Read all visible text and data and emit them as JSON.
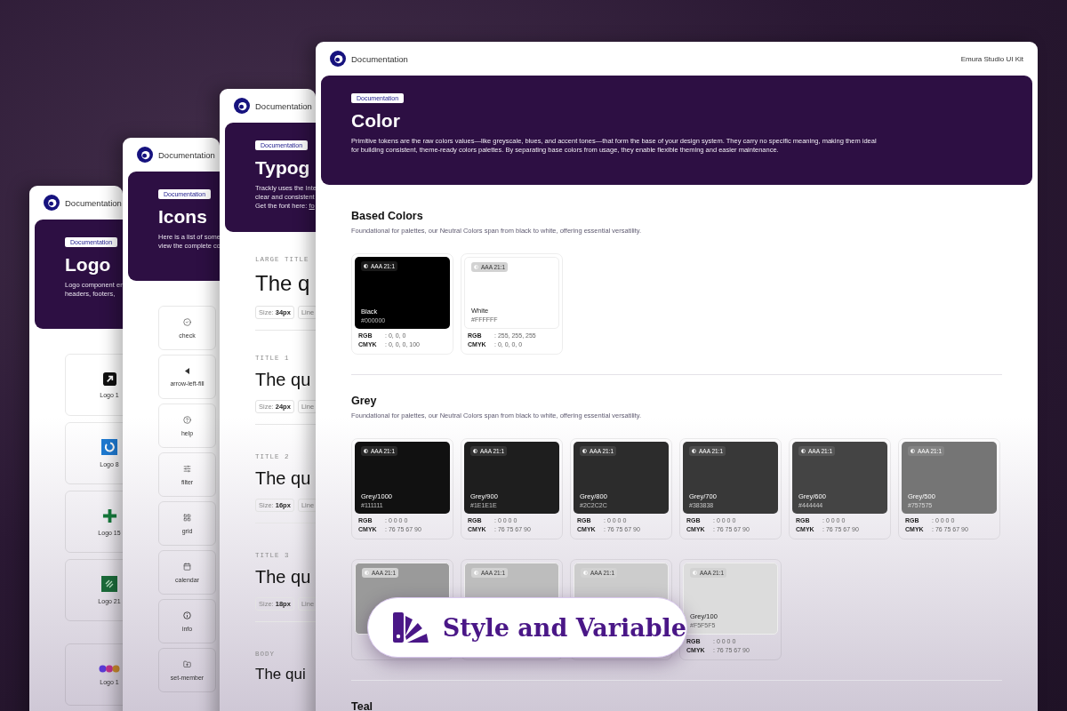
{
  "panels": [
    {
      "kind": "logos",
      "header": {
        "title": "Documentation"
      },
      "hero": {
        "badge": "Documentation",
        "title": "Logo",
        "description_lines": [
          "Logo component en",
          "headers, footers,"
        ]
      },
      "items": [
        {
          "label": "Logo 1"
        },
        {
          "label": "Logo 8"
        },
        {
          "label": "Logo 15"
        },
        {
          "label": "Logo 21"
        },
        {
          "label": "Logo 1"
        }
      ]
    },
    {
      "kind": "icons",
      "header": {
        "title": "Documentation"
      },
      "hero": {
        "badge": "Documentation",
        "title": "Icons",
        "description_lines": [
          "Here is a list of some",
          "view the complete co"
        ]
      },
      "items": [
        {
          "label": "check"
        },
        {
          "label": "arrow-left-fill"
        },
        {
          "label": "help"
        },
        {
          "label": "filter"
        },
        {
          "label": "grid"
        },
        {
          "label": "calendar"
        },
        {
          "label": "info"
        },
        {
          "label": "set-member"
        }
      ]
    },
    {
      "kind": "typography",
      "header": {
        "title": "Documentation"
      },
      "hero": {
        "badge": "Documentation",
        "title": "Typog",
        "description_lines": [
          "Trackly uses the Inte",
          "clear and consistent"
        ],
        "font_line": {
          "prefix": "Get the font here:",
          "link": "fo"
        }
      },
      "styles": [
        {
          "label": "LARGE TITLE",
          "sample": "The q",
          "size": "Size: **34px**",
          "line": "Line"
        },
        {
          "label": "TITLE 1",
          "sample": "The qu",
          "size": "Size: **24px**",
          "line": "Line"
        },
        {
          "label": "TITLE 2",
          "sample": "The qu",
          "size": "Size: **16px**",
          "line": "Line"
        },
        {
          "label": "TITLE 3",
          "sample": "The qu",
          "size": "Size: **18px**",
          "line": "Line"
        },
        {
          "label": "BODY",
          "sample": "The qui"
        }
      ]
    },
    {
      "kind": "colors",
      "header": {
        "title": "Documentation",
        "right": "Emura Studio UI Kit"
      },
      "hero": {
        "badge": "Documentation",
        "title": "Color",
        "description": "Primitive tokens are the raw colors values—like greyscale, blues, and accent tones—that form the base of your design system. They carry no specific meaning, making them ideal for building consistent, theme-ready colors palettes. By separating base colors from usage, they enable flexible theming and easier maintenance."
      },
      "sections": [
        {
          "title": "Based Colors",
          "subtitle": "Foundational for palettes, our Neutral Colors span from black to white, offering essential versatility.",
          "rows": [
            [
              {
                "tag": "AAA 21:1",
                "name": "Black",
                "hex": "#000000",
                "color": "#000000",
                "rgb_label": "RGB",
                "rgb": ": 0, 0, 0",
                "cmyk_label": "CMYK",
                "cmyk": ": 0, 0, 0, 100"
              },
              {
                "tag": "AAA 21:1",
                "name": "White",
                "hex": "#FFFFFF",
                "color": "#ffffff",
                "rgb_label": "RGB",
                "rgb": ": 255, 255, 255",
                "cmyk_label": "CMYK",
                "cmyk": ": 0, 0, 0, 0"
              }
            ]
          ]
        },
        {
          "title": "Grey",
          "subtitle": "Foundational for palettes, our Neutral Colors span from black to white, offering essential versatility.",
          "rows": [
            [
              {
                "tag": "AAA 21:1",
                "name": "Grey/1000",
                "hex": "#111111",
                "color": "#111111",
                "rgb_label": "RGB",
                "rgb": ": 0 0 0 0",
                "cmyk_label": "CMYK",
                "cmyk": ": 76 75 67 90"
              },
              {
                "tag": "AAA 21:1",
                "name": "Grey/900",
                "hex": "#1E1E1E",
                "color": "#1e1e1e",
                "rgb_label": "RGB",
                "rgb": ": 0 0 0 0",
                "cmyk_label": "CMYK",
                "cmyk": ": 76 75 67 90"
              },
              {
                "tag": "AAA 21:1",
                "name": "Grey/800",
                "hex": "#2C2C2C",
                "color": "#2c2c2c",
                "rgb_label": "RGB",
                "rgb": ": 0 0 0 0",
                "cmyk_label": "CMYK",
                "cmyk": ": 76 75 67 90"
              },
              {
                "tag": "AAA 21:1",
                "name": "Grey/700",
                "hex": "#383838",
                "color": "#383838",
                "rgb_label": "RGB",
                "rgb": ": 0 0 0 0",
                "cmyk_label": "CMYK",
                "cmyk": ": 76 75 67 90"
              },
              {
                "tag": "AAA 21:1",
                "name": "Grey/600",
                "hex": "#444444",
                "color": "#444444",
                "rgb_label": "RGB",
                "rgb": ": 0 0 0 0",
                "cmyk_label": "CMYK",
                "cmyk": ": 76 75 67 90"
              },
              {
                "tag": "AAA 21:1",
                "name": "Grey/500",
                "hex": "#757575",
                "color": "#757575",
                "rgb_label": "RGB",
                "rgb": ": 0 0 0 0",
                "cmyk_label": "CMYK",
                "cmyk": ": 76 75 67 90"
              }
            ],
            [
              {
                "tag": "AAA 21:1",
                "color": "#9a9a9a"
              },
              {
                "tag": "AAA 21:1",
                "color": "#bdbdbd"
              },
              {
                "tag": "AAA 21:1",
                "color": "#cccccc"
              },
              {
                "tag": "AAA 21:1",
                "name": "Grey/100",
                "hex": "#F5F5F5",
                "color": "#dcdcdc",
                "rgb_label": "RGB",
                "rgb": ": 0 0 0 0",
                "cmyk_label": "CMYK",
                "cmyk": ": 76 75 67 90"
              }
            ]
          ]
        },
        {
          "title": "Teal"
        }
      ]
    }
  ],
  "promo": {
    "label": "Style and Variable"
  }
}
